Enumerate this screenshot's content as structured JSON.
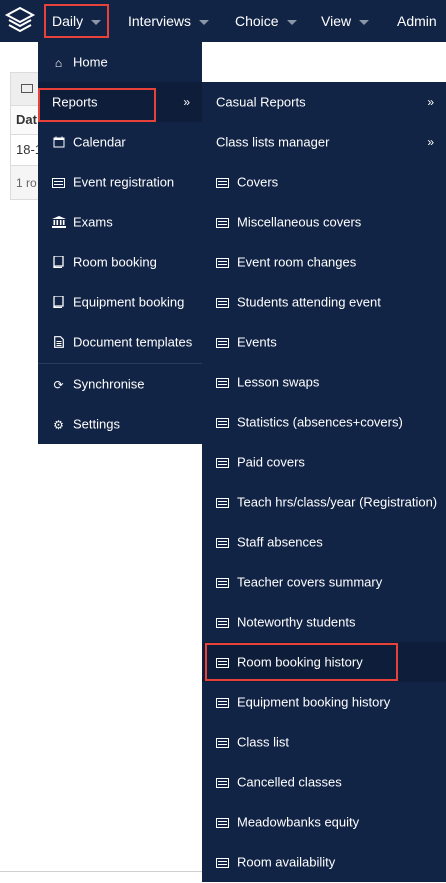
{
  "navbar": {
    "items": [
      {
        "label": "Daily"
      },
      {
        "label": "Interviews"
      },
      {
        "label": "Choice"
      },
      {
        "label": "View"
      },
      {
        "label": "Admin"
      }
    ]
  },
  "background_page": {
    "column_header": "Dat",
    "cell": "18-1",
    "footer": "1 ro"
  },
  "daily_menu": {
    "items": [
      {
        "label": "Home",
        "icon": "home-icon"
      },
      {
        "label": "Reports",
        "icon": "none",
        "arrow": "»"
      },
      {
        "label": "Calendar",
        "icon": "calendar-icon"
      },
      {
        "label": "Event registration",
        "icon": "list-icon"
      },
      {
        "label": "Exams",
        "icon": "bank-icon"
      },
      {
        "label": "Room booking",
        "icon": "book-icon"
      },
      {
        "label": "Equipment booking",
        "icon": "book-icon"
      },
      {
        "label": "Document templates",
        "icon": "document-icon"
      },
      {
        "label": "Synchronise",
        "icon": "sync-icon"
      },
      {
        "label": "Settings",
        "icon": "gear-icon"
      }
    ]
  },
  "reports_menu": {
    "items": [
      {
        "label": "Casual Reports",
        "arrow": "»"
      },
      {
        "label": "Class lists manager",
        "arrow": "»"
      },
      {
        "label": "Covers"
      },
      {
        "label": "Miscellaneous covers"
      },
      {
        "label": "Event room changes"
      },
      {
        "label": "Students attending event"
      },
      {
        "label": "Events"
      },
      {
        "label": "Lesson swaps"
      },
      {
        "label": "Statistics (absences+covers)"
      },
      {
        "label": "Paid covers"
      },
      {
        "label": "Teach hrs/class/year (Registration)"
      },
      {
        "label": "Staff absences"
      },
      {
        "label": "Teacher covers summary"
      },
      {
        "label": "Noteworthy students"
      },
      {
        "label": "Room booking history"
      },
      {
        "label": "Equipment booking history"
      },
      {
        "label": "Class list"
      },
      {
        "label": "Cancelled classes"
      },
      {
        "label": "Meadowbanks equity"
      },
      {
        "label": "Room availability"
      }
    ]
  },
  "colors": {
    "nav_bg": "#122446",
    "highlight": "#e8413a"
  }
}
